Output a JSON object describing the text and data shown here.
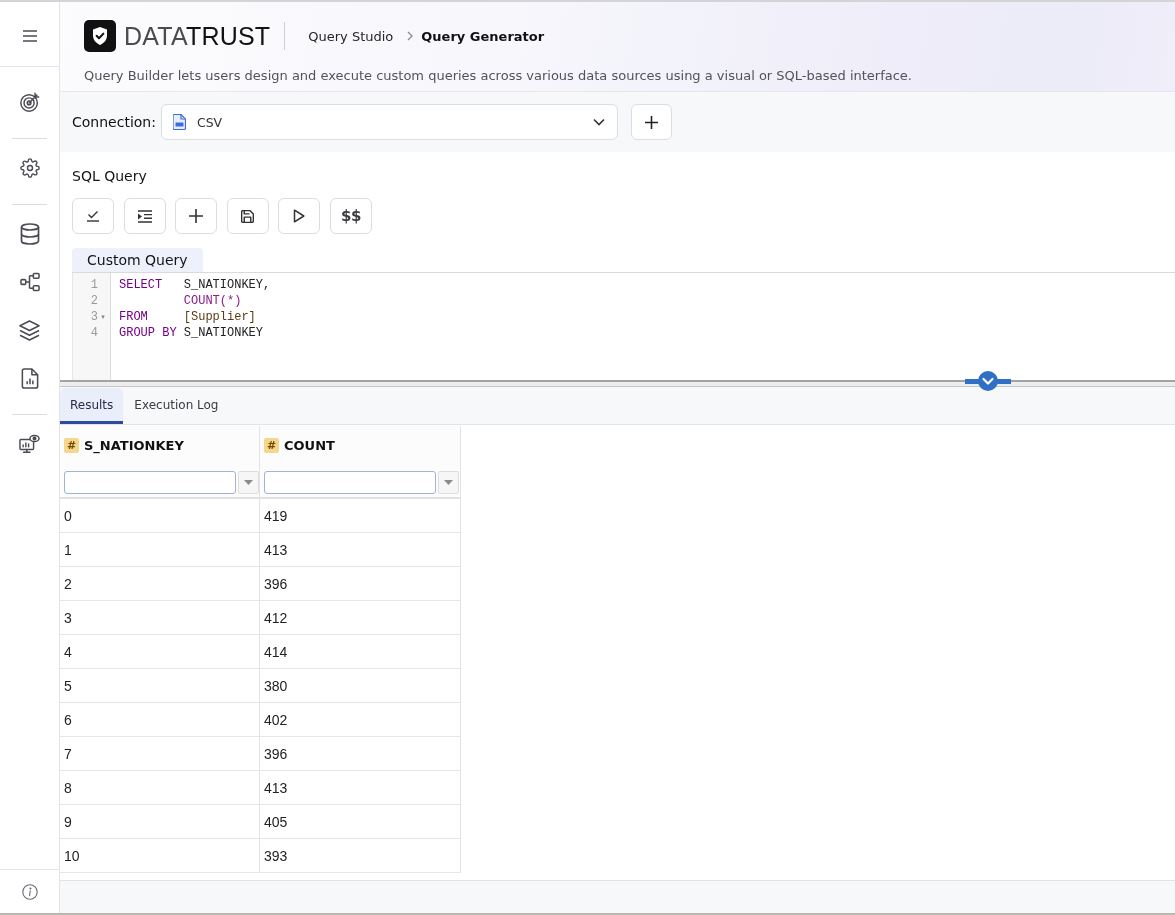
{
  "header": {
    "logo": {
      "parts": [
        "DATA",
        "TRUST"
      ]
    },
    "breadcrumb": [
      "Query Studio",
      "Query Generator"
    ],
    "description": "Query Builder lets users design and execute custom queries across various data sources using a visual or SQL-based interface."
  },
  "connection": {
    "label": "Connection:",
    "value": "CSV"
  },
  "editor": {
    "title": "SQL Query",
    "text_button": "$$",
    "tab": "Custom Query",
    "lines": [
      {
        "number": "1",
        "keyword": "SELECT",
        "code": {
          "kind": "plain",
          "text": "S_NATIONKEY,"
        }
      },
      {
        "number": "2",
        "code": {
          "kind": "builtin",
          "text": "COUNT(*)"
        }
      },
      {
        "number": "3",
        "fold_marker": "▾",
        "keyword": "FROM",
        "code": {
          "kind": "table",
          "text": "[Supplier]"
        }
      },
      {
        "number": "4",
        "keyword": "GROUP BY",
        "code": {
          "kind": "plain",
          "text": "S_NATIONKEY"
        }
      }
    ]
  },
  "results_tabs": [
    {
      "label": "Results",
      "selected": true
    },
    {
      "label": "Execution Log",
      "selected": false
    }
  ],
  "table": {
    "columns": [
      {
        "type_badge": "#",
        "name": "S_NATIONKEY"
      },
      {
        "type_badge": "#",
        "name": "COUNT"
      }
    ],
    "rows": [
      [
        "0",
        "419"
      ],
      [
        "1",
        "413"
      ],
      [
        "2",
        "396"
      ],
      [
        "3",
        "412"
      ],
      [
        "4",
        "414"
      ],
      [
        "5",
        "380"
      ],
      [
        "6",
        "402"
      ],
      [
        "7",
        "396"
      ],
      [
        "8",
        "413"
      ],
      [
        "9",
        "405"
      ],
      [
        "10",
        "393"
      ]
    ]
  }
}
